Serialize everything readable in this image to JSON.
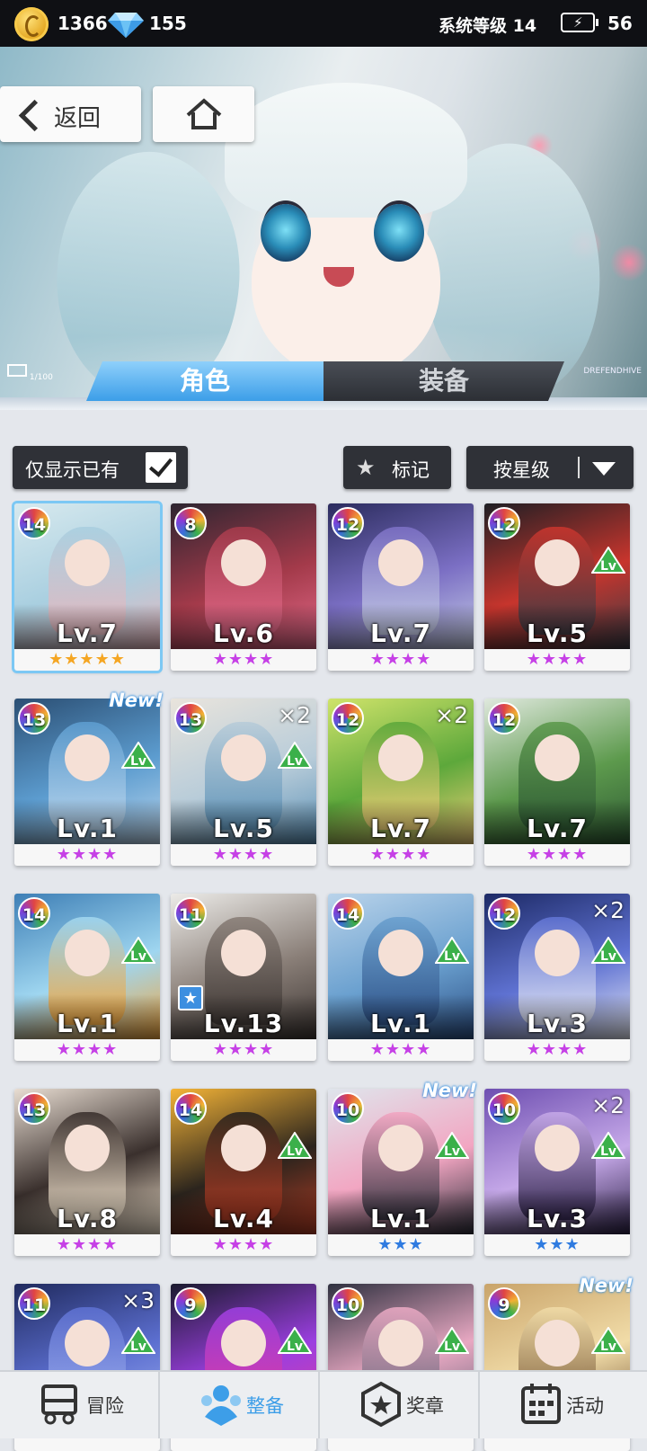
{
  "topbar": {
    "coins": "1366",
    "gems": "155",
    "system_level": "系统等级 14",
    "battery": "56"
  },
  "banner": {
    "back_label": "返回",
    "side_counter": "1/100",
    "side_code": "DREFENDHIVE"
  },
  "tabs": [
    {
      "label": "角色",
      "active": true
    },
    {
      "label": "装备",
      "active": false
    }
  ],
  "filters": {
    "show_owned_label": "仅显示已有",
    "show_owned_checked": true,
    "mark_label": "标记",
    "sort_label": "按星级"
  },
  "colors": {
    "accent_blue": "#3d9ee8",
    "star_gold": "#f5a623",
    "star_purple": "#c640e6",
    "star_blue": "#2f7be0"
  },
  "characters": [
    {
      "badge": "14",
      "level": "Lv.7",
      "stars": "★★★★★",
      "star_color": "#f5a623",
      "dup": "",
      "levelup": false,
      "new": false,
      "marked": false,
      "selected": true,
      "tone": [
        "#d7e9ee",
        "#a9cfe0",
        "#e8b7bd"
      ],
      "badge_bg": "#3c8c3c"
    },
    {
      "badge": "8",
      "level": "Lv.6",
      "stars": "★★★★",
      "star_color": "#c640e6",
      "dup": "",
      "levelup": false,
      "new": false,
      "marked": false,
      "selected": false,
      "tone": [
        "#2d2530",
        "#a33a4a",
        "#e36a8a"
      ],
      "badge_bg": "#c23a2a"
    },
    {
      "badge": "12",
      "level": "Lv.7",
      "stars": "★★★★",
      "star_color": "#c640e6",
      "dup": "",
      "levelup": false,
      "new": false,
      "marked": false,
      "selected": false,
      "tone": [
        "#2b2c5e",
        "#7b6fc4",
        "#c6cde6"
      ],
      "badge_bg": "#6a3aa8"
    },
    {
      "badge": "12",
      "level": "Lv.5",
      "stars": "★★★★",
      "star_color": "#c640e6",
      "dup": "",
      "levelup": true,
      "new": false,
      "marked": false,
      "selected": false,
      "tone": [
        "#1f1f24",
        "#c7352d",
        "#3b3b44"
      ],
      "badge_bg": "#b02a28"
    },
    {
      "badge": "13",
      "level": "Lv.1",
      "stars": "★★★★",
      "star_color": "#c640e6",
      "dup": "",
      "levelup": true,
      "new": true,
      "marked": false,
      "selected": false,
      "tone": [
        "#2b4f74",
        "#5c9ccf",
        "#bcd7ee"
      ],
      "badge_bg": "#3a4db8"
    },
    {
      "badge": "13",
      "level": "Lv.5",
      "stars": "★★★★",
      "star_color": "#c640e6",
      "dup": "×2",
      "levelup": true,
      "new": false,
      "marked": false,
      "selected": false,
      "tone": [
        "#e9e4dc",
        "#b8ccd9",
        "#5b91b7"
      ],
      "badge_bg": "#3a8a3a"
    },
    {
      "badge": "12",
      "level": "Lv.7",
      "stars": "★★★★",
      "star_color": "#c640e6",
      "dup": "×2",
      "levelup": false,
      "new": false,
      "marked": false,
      "selected": false,
      "tone": [
        "#cfe36a",
        "#5da83b",
        "#f3d078"
      ],
      "badge_bg": "#5a3aa8"
    },
    {
      "badge": "12",
      "level": "Lv.7",
      "stars": "★★★★",
      "star_color": "#c640e6",
      "dup": "",
      "levelup": false,
      "new": false,
      "marked": false,
      "selected": false,
      "tone": [
        "#dfe8dd",
        "#5d9a4d",
        "#2e5a34"
      ],
      "badge_bg": "#3a8a3a"
    },
    {
      "badge": "14",
      "level": "Lv.1",
      "stars": "★★★★",
      "star_color": "#c640e6",
      "dup": "",
      "levelup": true,
      "new": false,
      "marked": false,
      "selected": false,
      "tone": [
        "#3e7fb6",
        "#9fd6f0",
        "#f3a53a"
      ],
      "badge_bg": "#3a8a3a"
    },
    {
      "badge": "11",
      "level": "Lv.13",
      "stars": "★★★★",
      "star_color": "#c640e6",
      "dup": "",
      "levelup": false,
      "new": false,
      "marked": true,
      "selected": false,
      "tone": [
        "#ecebe8",
        "#8a7f78",
        "#3d3633"
      ],
      "badge_bg": "#b52a2a"
    },
    {
      "badge": "14",
      "level": "Lv.1",
      "stars": "★★★★",
      "star_color": "#c640e6",
      "dup": "",
      "levelup": true,
      "new": false,
      "marked": false,
      "selected": false,
      "tone": [
        "#b9d3ea",
        "#6aa0cf",
        "#2c4f85"
      ],
      "badge_bg": "#3a8a3a"
    },
    {
      "badge": "12",
      "level": "Lv.3",
      "stars": "★★★★",
      "star_color": "#c640e6",
      "dup": "×2",
      "levelup": true,
      "new": false,
      "marked": false,
      "selected": false,
      "tone": [
        "#1d2a66",
        "#5f72d2",
        "#e6e9f6"
      ],
      "badge_bg": "#5a3aa8"
    },
    {
      "badge": "13",
      "level": "Lv.8",
      "stars": "★★★★",
      "star_color": "#c640e6",
      "dup": "",
      "levelup": false,
      "new": false,
      "marked": false,
      "selected": false,
      "tone": [
        "#e8ddd2",
        "#3a302d",
        "#f5e6d0"
      ],
      "badge_bg": "#b06a2a"
    },
    {
      "badge": "14",
      "level": "Lv.4",
      "stars": "★★★★",
      "star_color": "#c640e6",
      "dup": "",
      "levelup": true,
      "new": false,
      "marked": false,
      "selected": false,
      "tone": [
        "#f4b437",
        "#2b241d",
        "#b23c24"
      ],
      "badge_bg": "#3a8a3a"
    },
    {
      "badge": "10",
      "level": "Lv.1",
      "stars": "★★★",
      "star_color": "#2f7be0",
      "dup": "",
      "levelup": true,
      "new": true,
      "marked": false,
      "selected": false,
      "tone": [
        "#dfe5ec",
        "#f2a6c2",
        "#2d2e3a"
      ],
      "badge_bg": "#3a8a3a"
    },
    {
      "badge": "10",
      "level": "Lv.3",
      "stars": "★★★",
      "star_color": "#2f7be0",
      "dup": "×2",
      "levelup": true,
      "new": false,
      "marked": false,
      "selected": false,
      "tone": [
        "#6e4fb1",
        "#c5a8e8",
        "#2c2146"
      ],
      "badge_bg": "#3a8a3a"
    },
    {
      "badge": "11",
      "level": "",
      "stars": "",
      "star_color": "#c640e6",
      "dup": "×3",
      "levelup": true,
      "new": false,
      "marked": false,
      "selected": false,
      "tone": [
        "#202a5e",
        "#5c6fd0",
        "#9fb0ef"
      ],
      "badge_bg": "#3a8a3a"
    },
    {
      "badge": "9",
      "level": "",
      "stars": "",
      "star_color": "#c640e6",
      "dup": "",
      "levelup": true,
      "new": false,
      "marked": false,
      "selected": false,
      "tone": [
        "#1a1a2e",
        "#9b3fe0",
        "#e33a9a"
      ],
      "badge_bg": "#b52a2a"
    },
    {
      "badge": "10",
      "level": "",
      "stars": "",
      "star_color": "#c640e6",
      "dup": "",
      "levelup": true,
      "new": false,
      "marked": false,
      "selected": false,
      "tone": [
        "#2f3140",
        "#e8a8c2",
        "#5a5e72"
      ],
      "badge_bg": "#3a8a3a"
    },
    {
      "badge": "9",
      "level": "",
      "stars": "",
      "star_color": "#c640e6",
      "dup": "",
      "levelup": true,
      "new": true,
      "marked": false,
      "selected": false,
      "tone": [
        "#c9a46a",
        "#f1dca8",
        "#6b4a2a"
      ],
      "badge_bg": "#b52a2a"
    }
  ],
  "levelup_label": "Lv",
  "new_label": "New!",
  "bottom_nav": [
    {
      "label": "冒险",
      "icon": "truck-icon",
      "active": false
    },
    {
      "label": "整备",
      "icon": "team-icon",
      "active": true
    },
    {
      "label": "奖章",
      "icon": "medal-icon",
      "active": false
    },
    {
      "label": "活动",
      "icon": "calendar-icon",
      "active": false
    }
  ]
}
